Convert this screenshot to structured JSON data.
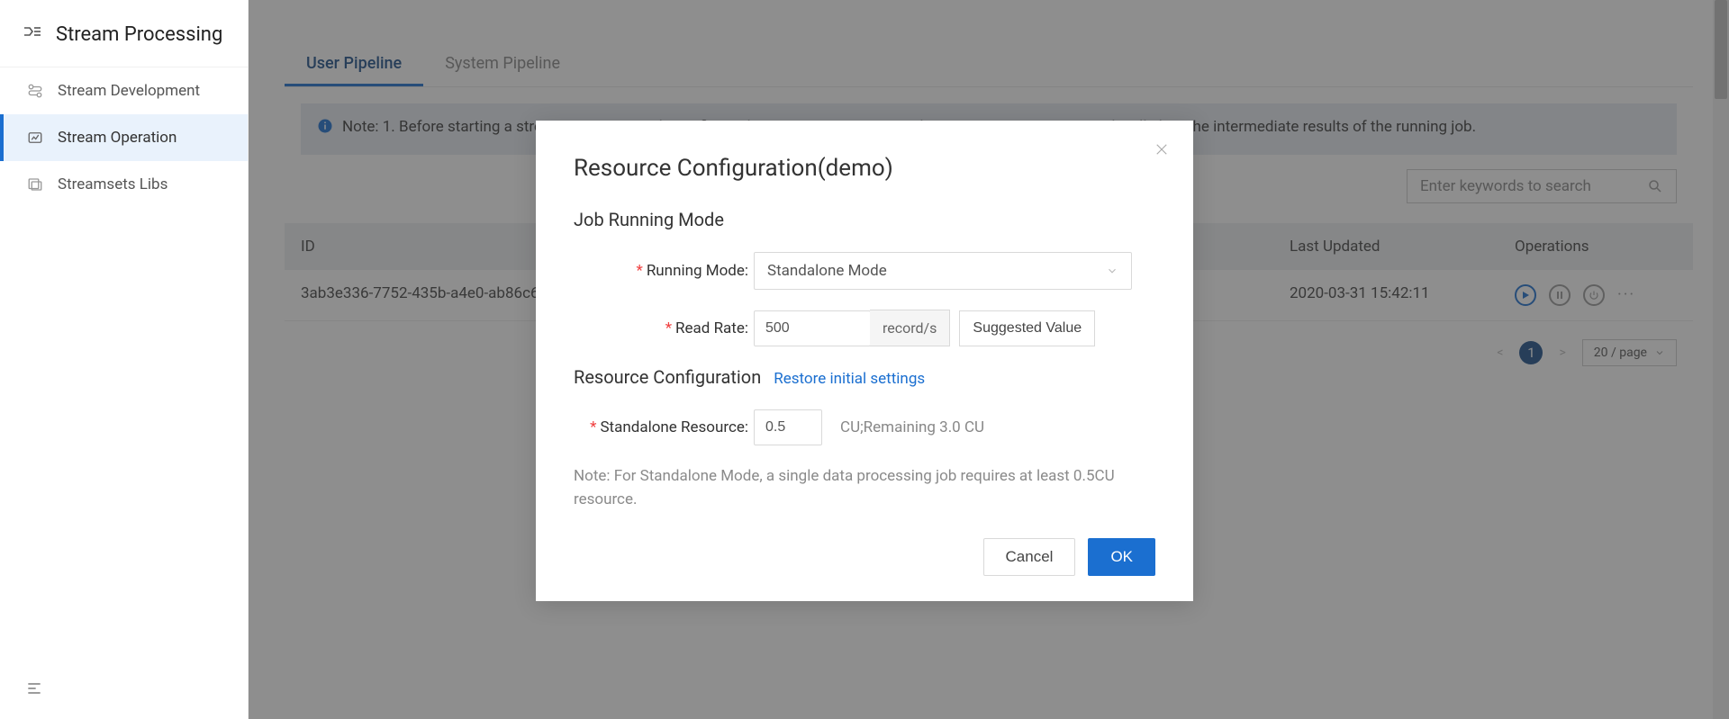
{
  "sidebar": {
    "title": "Stream Processing",
    "items": [
      {
        "label": "Stream Development"
      },
      {
        "label": "Stream Operation"
      },
      {
        "label": "Streamsets Libs"
      }
    ],
    "active_index": 1
  },
  "tabs": {
    "items": [
      {
        "label": "User Pipeline"
      },
      {
        "label": "System Pipeline"
      }
    ],
    "active_index": 0
  },
  "info_banner": "Note: 1. Before starting a stream processing job, configure the running resource. 2. Editing a stream processing job will clear the intermediate results of the running job.",
  "search": {
    "placeholder": "Enter keywords to search"
  },
  "table": {
    "columns": {
      "id": "ID",
      "updated": "Last Updated",
      "operations": "Operations"
    },
    "rows": [
      {
        "id": "3ab3e336-7752-435b-a4e0-ab86c604fe14",
        "updated": "2020-03-31 15:42:11"
      }
    ]
  },
  "pagination": {
    "current": "1",
    "page_size": "20 / page"
  },
  "modal": {
    "title": "Resource Configuration(demo)",
    "section_running_mode": "Job Running Mode",
    "running_mode_label": "Running Mode:",
    "running_mode_value": "Standalone Mode",
    "read_rate_label": "Read Rate:",
    "read_rate_value": "500",
    "read_rate_unit": "record/s",
    "suggested_button": "Suggested Value",
    "section_resource": "Resource Configuration",
    "restore_link": "Restore initial settings",
    "standalone_resource_label": "Standalone Resource:",
    "standalone_resource_value": "0.5",
    "standalone_resource_hint": "CU;Remaining 3.0 CU",
    "note": "Note: For Standalone Mode, a single data processing job requires at least 0.5CU resource.",
    "cancel": "Cancel",
    "ok": "OK"
  }
}
